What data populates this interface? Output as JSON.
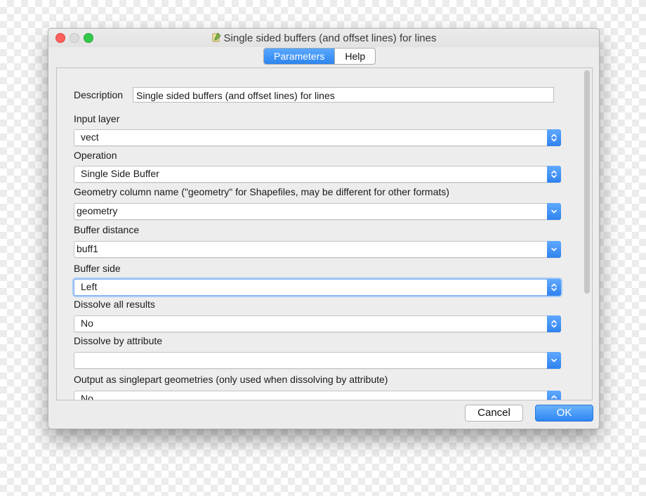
{
  "window": {
    "title": "Single sided buffers (and offset lines) for lines",
    "title_icon": "qgis-script-icon"
  },
  "tabs": [
    {
      "label": "Parameters",
      "active": true
    },
    {
      "label": "Help",
      "active": false
    }
  ],
  "form": {
    "description": {
      "label": "Description",
      "value": "Single sided buffers (and offset lines) for lines"
    },
    "input_layer": {
      "label": "Input layer",
      "value": "vect"
    },
    "operation": {
      "label": "Operation",
      "value": "Single Side Buffer"
    },
    "geometry_column": {
      "label": "Geometry column name (\"geometry\" for Shapefiles, may be different for other formats)",
      "value": "geometry"
    },
    "buffer_distance": {
      "label": "Buffer distance",
      "value": "buff1"
    },
    "buffer_side": {
      "label": "Buffer side",
      "value": "Left"
    },
    "dissolve_all": {
      "label": "Dissolve all results",
      "value": "No"
    },
    "dissolve_by_attribute": {
      "label": "Dissolve by attribute",
      "value": ""
    },
    "output_singlepart": {
      "label": "Output as singlepart geometries (only used when dissolving by attribute)",
      "value": "No"
    }
  },
  "buttons": {
    "cancel": "Cancel",
    "ok": "OK"
  },
  "colors": {
    "accent": "#2e85ef",
    "close_light": "#fc605c",
    "max_light": "#34c84a"
  }
}
